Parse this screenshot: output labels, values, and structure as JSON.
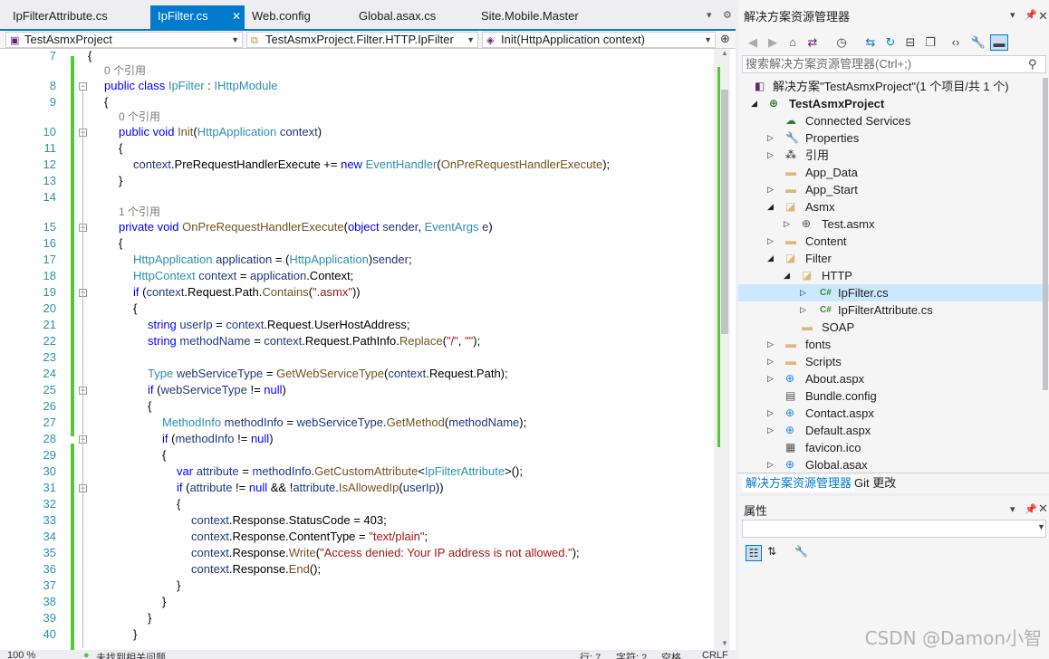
{
  "tabs": [
    {
      "label": "IpFilterAttribute.cs",
      "active": false
    },
    {
      "label": "IpFilter.cs",
      "active": true
    },
    {
      "label": "Web.config",
      "active": false
    },
    {
      "label": "Global.asax.cs",
      "active": false
    },
    {
      "label": "Site.Mobile.Master",
      "active": false
    }
  ],
  "tab_close_glyph": "✕",
  "navbar": {
    "project": "TestAsmxProject",
    "type": "TestAsmxProject.Filter.HTTP.IpFilter",
    "member": "Init(HttpApplication context)"
  },
  "code": {
    "line_numbers": [
      "7",
      "8",
      "9",
      "10",
      "11",
      "12",
      "13",
      "14",
      "15",
      "16",
      "17",
      "18",
      "19",
      "20",
      "21",
      "22",
      "23",
      "24",
      "25",
      "26",
      "27",
      "28",
      "29",
      "30",
      "31",
      "32",
      "33",
      "34",
      "35",
      "36",
      "37",
      "38",
      "39",
      "40"
    ],
    "references": {
      "class_refs": "0 个引用",
      "init_refs": "0 个引用",
      "handler_refs": "1 个引用"
    }
  },
  "editor_status": {
    "zoom": "100 %",
    "issues": "未找到相关问题",
    "line": "行: 7",
    "char": "字符: 2",
    "spaces": "空格",
    "eol": "CRLF"
  },
  "solution_explorer": {
    "title": "解决方案资源管理器",
    "search_placeholder": "搜索解决方案资源管理器(Ctrl+;)",
    "items": [
      {
        "label": "解决方案\"TestAsmxProject\"(1 个项目/共 1 个)",
        "icon": "solution-icon",
        "bold": false
      },
      {
        "label": "TestAsmxProject",
        "icon": "web-project-icon",
        "bold": true
      },
      {
        "label": "Connected Services",
        "icon": "connected-services-icon"
      },
      {
        "label": "Properties",
        "icon": "wrench-icon"
      },
      {
        "label": "引用",
        "icon": "references-icon"
      },
      {
        "label": "App_Data",
        "icon": "folder-icon"
      },
      {
        "label": "App_Start",
        "icon": "folder-icon"
      },
      {
        "label": "Asmx",
        "icon": "folder-open-icon"
      },
      {
        "label": "Test.asmx",
        "icon": "asmx-file-icon"
      },
      {
        "label": "Content",
        "icon": "folder-icon"
      },
      {
        "label": "Filter",
        "icon": "folder-open-icon"
      },
      {
        "label": "HTTP",
        "icon": "folder-open-icon"
      },
      {
        "label": "IpFilter.cs",
        "icon": "csharp-file-icon",
        "selected": true
      },
      {
        "label": "IpFilterAttribute.cs",
        "icon": "csharp-file-icon"
      },
      {
        "label": "SOAP",
        "icon": "folder-icon"
      },
      {
        "label": "fonts",
        "icon": "folder-icon"
      },
      {
        "label": "Scripts",
        "icon": "folder-icon"
      },
      {
        "label": "About.aspx",
        "icon": "aspx-file-icon"
      },
      {
        "label": "Bundle.config",
        "icon": "config-file-icon"
      },
      {
        "label": "Contact.aspx",
        "icon": "aspx-file-icon"
      },
      {
        "label": "Default.aspx",
        "icon": "aspx-file-icon"
      },
      {
        "label": "favicon.ico",
        "icon": "ico-file-icon"
      },
      {
        "label": "Global.asax",
        "icon": "asax-file-icon"
      }
    ],
    "bottom_tabs": [
      "解决方案资源管理器",
      "Git 更改"
    ]
  },
  "properties": {
    "title": "属性"
  },
  "watermark": "CSDN @Damon小智",
  "colors": {
    "accent": "#007acc",
    "keyword": "#0000ff",
    "type": "#2b91af",
    "string": "#a31515",
    "method": "#74531f",
    "change_bar": "#57c73a",
    "selection": "#cce8ff"
  }
}
